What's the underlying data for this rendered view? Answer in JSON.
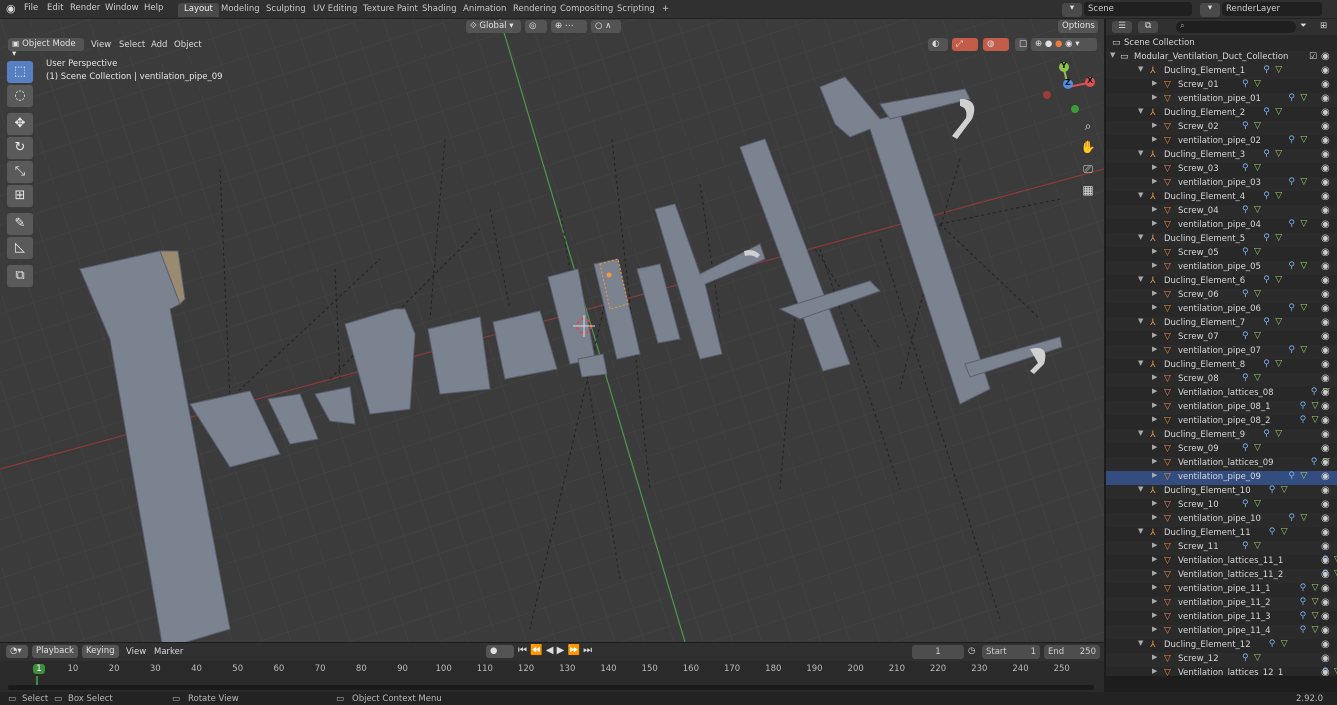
{
  "topbar": {
    "menus": [
      "File",
      "Edit",
      "Render",
      "Window",
      "Help"
    ],
    "workspaces": [
      "Layout",
      "Modeling",
      "Sculpting",
      "UV Editing",
      "Texture Paint",
      "Shading",
      "Animation",
      "Rendering",
      "Compositing",
      "Scripting"
    ],
    "add_tab": "+",
    "scene": "Scene",
    "render_layer": "RenderLayer"
  },
  "viewport": {
    "mode": "Object Mode",
    "menus": [
      "View",
      "Select",
      "Add",
      "Object"
    ],
    "transform": "Global",
    "options": "Options",
    "overlay_title": "User Perspective",
    "overlay_sub": "(1) Scene Collection | ventilation_pipe_09",
    "gizmo": {
      "x": "X",
      "y": "Y",
      "z": "Z"
    }
  },
  "outliner": {
    "root": "Scene Collection",
    "collection": "Modular_Ventilation_Duct_Collection",
    "rows": [
      {
        "d": 2,
        "t": "e",
        "l": "Ducling_Element_1"
      },
      {
        "d": 3,
        "t": "m",
        "l": "Screw_01"
      },
      {
        "d": 3,
        "t": "m",
        "l": "ventilation_pipe_01"
      },
      {
        "d": 2,
        "t": "e",
        "l": "Ducling_Element_2"
      },
      {
        "d": 3,
        "t": "m",
        "l": "Screw_02"
      },
      {
        "d": 3,
        "t": "m",
        "l": "ventilation_pipe_02"
      },
      {
        "d": 2,
        "t": "e",
        "l": "Ducling_Element_3"
      },
      {
        "d": 3,
        "t": "m",
        "l": "Screw_03"
      },
      {
        "d": 3,
        "t": "m",
        "l": "ventilation_pipe_03"
      },
      {
        "d": 2,
        "t": "e",
        "l": "Ducling_Element_4"
      },
      {
        "d": 3,
        "t": "m",
        "l": "Screw_04"
      },
      {
        "d": 3,
        "t": "m",
        "l": "ventilation_pipe_04"
      },
      {
        "d": 2,
        "t": "e",
        "l": "Ducling_Element_5"
      },
      {
        "d": 3,
        "t": "m",
        "l": "Screw_05"
      },
      {
        "d": 3,
        "t": "m",
        "l": "ventilation_pipe_05"
      },
      {
        "d": 2,
        "t": "e",
        "l": "Ducling_Element_6"
      },
      {
        "d": 3,
        "t": "m",
        "l": "Screw_06"
      },
      {
        "d": 3,
        "t": "m",
        "l": "ventilation_pipe_06"
      },
      {
        "d": 2,
        "t": "e",
        "l": "Ducling_Element_7"
      },
      {
        "d": 3,
        "t": "m",
        "l": "Screw_07"
      },
      {
        "d": 3,
        "t": "m",
        "l": "ventilation_pipe_07"
      },
      {
        "d": 2,
        "t": "e",
        "l": "Ducling_Element_8"
      },
      {
        "d": 3,
        "t": "m",
        "l": "Screw_08"
      },
      {
        "d": 3,
        "t": "m",
        "l": "Ventilation_lattices_08"
      },
      {
        "d": 3,
        "t": "m",
        "l": "ventilation_pipe_08_1"
      },
      {
        "d": 3,
        "t": "m",
        "l": "ventilation_pipe_08_2"
      },
      {
        "d": 2,
        "t": "e",
        "l": "Ducling_Element_9"
      },
      {
        "d": 3,
        "t": "m",
        "l": "Screw_09"
      },
      {
        "d": 3,
        "t": "m",
        "l": "Ventilation_lattices_09"
      },
      {
        "d": 3,
        "t": "m",
        "l": "ventilation_pipe_09",
        "sel": true
      },
      {
        "d": 2,
        "t": "e",
        "l": "Ducling_Element_10"
      },
      {
        "d": 3,
        "t": "m",
        "l": "Screw_10"
      },
      {
        "d": 3,
        "t": "m",
        "l": "ventilation_pipe_10"
      },
      {
        "d": 2,
        "t": "e",
        "l": "Ducling_Element_11"
      },
      {
        "d": 3,
        "t": "m",
        "l": "Screw_11"
      },
      {
        "d": 3,
        "t": "m",
        "l": "Ventilation_lattices_11_1"
      },
      {
        "d": 3,
        "t": "m",
        "l": "Ventilation_lattices_11_2"
      },
      {
        "d": 3,
        "t": "m",
        "l": "ventilation_pipe_11_1"
      },
      {
        "d": 3,
        "t": "m",
        "l": "ventilation_pipe_11_2"
      },
      {
        "d": 3,
        "t": "m",
        "l": "ventilation_pipe_11_3"
      },
      {
        "d": 3,
        "t": "m",
        "l": "ventilation_pipe_11_4"
      },
      {
        "d": 2,
        "t": "e",
        "l": "Ducling_Element_12"
      },
      {
        "d": 3,
        "t": "m",
        "l": "Screw_12"
      },
      {
        "d": 3,
        "t": "m",
        "l": "Ventilation_lattices_12_1"
      }
    ]
  },
  "timeline": {
    "menus": [
      "Playback",
      "Keying",
      "View",
      "Marker"
    ],
    "current_frame": "1",
    "start_label": "Start",
    "start": "1",
    "end_label": "End",
    "end": "250",
    "ticks": [
      "1",
      "10",
      "20",
      "30",
      "40",
      "50",
      "60",
      "70",
      "80",
      "90",
      "100",
      "110",
      "120",
      "130",
      "140",
      "150",
      "160",
      "170",
      "180",
      "190",
      "200",
      "210",
      "220",
      "230",
      "240",
      "250"
    ],
    "playhead": "1"
  },
  "statusbar": {
    "select": "Select",
    "box_select": "Box Select",
    "rotate_view": "Rotate View",
    "context_menu": "Object Context Menu",
    "version": "2.92.0"
  }
}
